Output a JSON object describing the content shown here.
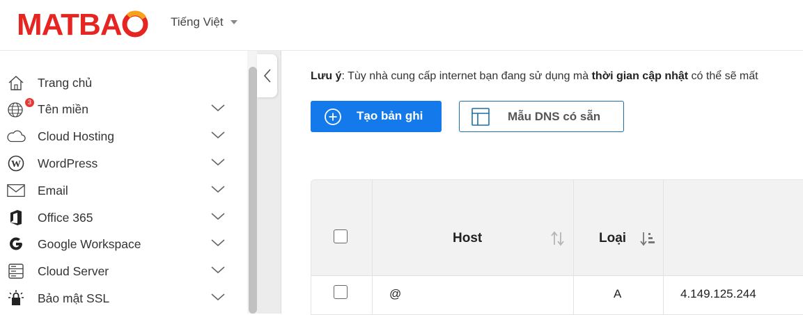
{
  "brand": {
    "logo_text": "MATBAO",
    "logo_color": "#e52521"
  },
  "header": {
    "language": "Tiếng Việt"
  },
  "sidebar": {
    "items": [
      {
        "label": "Trang chủ",
        "icon": "home-icon",
        "has_chevron": false
      },
      {
        "label": "Tên miền",
        "icon": "globe-icon",
        "badge": "3",
        "has_chevron": true
      },
      {
        "label": "Cloud Hosting",
        "icon": "cloud-icon",
        "has_chevron": true
      },
      {
        "label": "WordPress",
        "icon": "wordpress-icon",
        "has_chevron": true
      },
      {
        "label": "Email",
        "icon": "mail-icon",
        "has_chevron": true
      },
      {
        "label": "Office 365",
        "icon": "office-icon",
        "has_chevron": true
      },
      {
        "label": "Google Workspace",
        "icon": "google-icon",
        "has_chevron": true
      },
      {
        "label": "Cloud Server",
        "icon": "server-icon",
        "has_chevron": true
      },
      {
        "label": "Bảo mật SSL",
        "icon": "lock-icon",
        "has_chevron": true
      }
    ]
  },
  "main": {
    "note_label": "Lưu ý",
    "note_text_1": ": Tùy nhà cung cấp internet bạn đang sử dụng mà ",
    "note_bold": "thời gian cập nhật",
    "note_text_2": " có thể sẽ mất",
    "create_button": "Tạo bản ghi",
    "template_button": "Mẫu DNS có sẵn",
    "accent_color": "#1479ea"
  },
  "table": {
    "headers": {
      "host": "Host",
      "type": "Loại"
    },
    "rows": [
      {
        "host": "@",
        "type": "A",
        "value": "4.149.125.244"
      }
    ]
  }
}
